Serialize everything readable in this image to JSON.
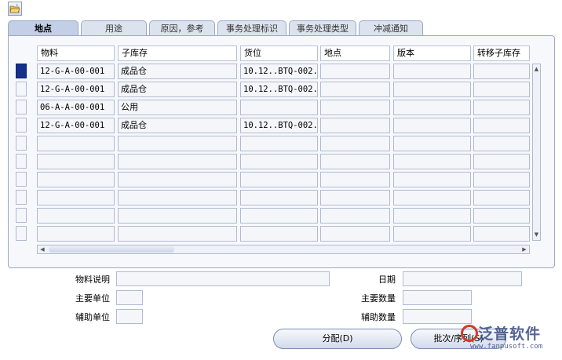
{
  "toolbar": {
    "icon": "open-folder-icon"
  },
  "tabs": [
    {
      "label": "地点",
      "active": true
    },
    {
      "label": "用途",
      "active": false
    },
    {
      "label": "原因，参考",
      "active": false
    },
    {
      "label": "事务处理标识",
      "active": false
    },
    {
      "label": "事务处理类型",
      "active": false
    },
    {
      "label": "冲减通知",
      "active": false
    }
  ],
  "grid": {
    "columns": [
      "物料",
      "子库存",
      "货位",
      "地点",
      "版本",
      "转移子库存"
    ],
    "rows": [
      [
        "12-G-A-00-001",
        "成品仓",
        "10.12..BTQ-002.",
        "",
        "",
        ""
      ],
      [
        "12-G-A-00-001",
        "成品仓",
        "10.12..BTQ-002.",
        "",
        "",
        ""
      ],
      [
        "06-A-A-00-001",
        "公用",
        "",
        "",
        "",
        ""
      ],
      [
        "12-G-A-00-001",
        "成品仓",
        "10.12..BTQ-002.",
        "",
        "",
        ""
      ],
      [
        "",
        "",
        "",
        "",
        "",
        ""
      ],
      [
        "",
        "",
        "",
        "",
        "",
        ""
      ],
      [
        "",
        "",
        "",
        "",
        "",
        ""
      ],
      [
        "",
        "",
        "",
        "",
        "",
        ""
      ],
      [
        "",
        "",
        "",
        "",
        "",
        ""
      ],
      [
        "",
        "",
        "",
        "",
        "",
        ""
      ]
    ]
  },
  "details": {
    "item_desc_label": "物料说明",
    "item_desc_value": "",
    "primary_uom_label": "主要单位",
    "primary_uom_value": "",
    "secondary_uom_label": "辅助单位",
    "secondary_uom_value": "",
    "date_label": "日期",
    "date_value": "",
    "primary_qty_label": "主要数量",
    "primary_qty_value": "",
    "secondary_qty_label": "辅助数量",
    "secondary_qty_value": ""
  },
  "buttons": {
    "distribute": "分配(D)",
    "lot_serial": "批次/序列(S)"
  },
  "watermark": {
    "name": "泛普软件",
    "url": "www.fanpusoft.com"
  },
  "colors": {
    "selected_row": "#14308a",
    "active_cell": "#1f3f99",
    "panel_border": "#9aa8c4",
    "field_border": "#b0bbd0"
  }
}
